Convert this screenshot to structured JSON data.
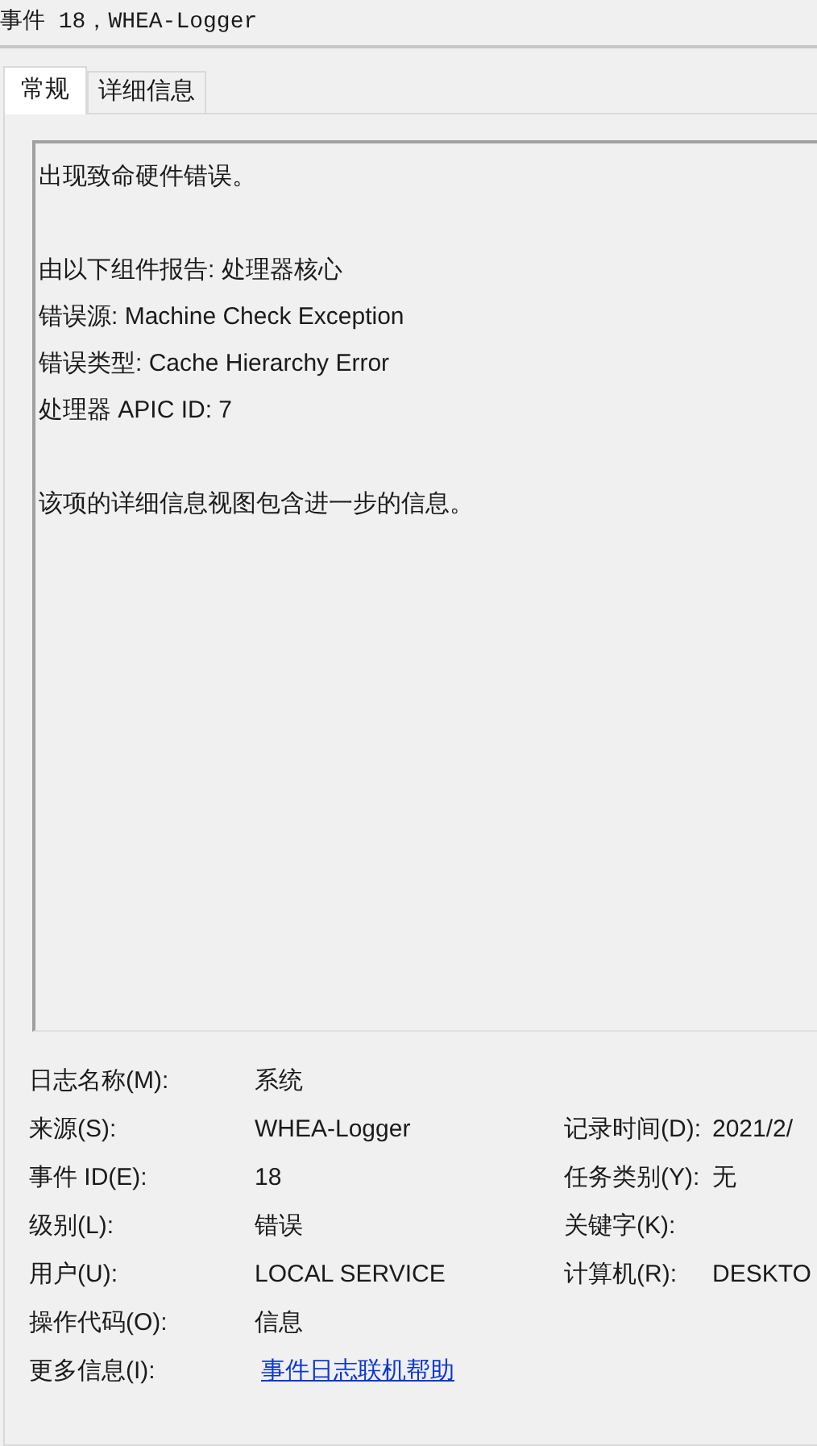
{
  "window": {
    "title": "事件 18，WHEA-Logger"
  },
  "tabs": [
    {
      "label": "常规",
      "selected": true
    },
    {
      "label": "详细信息",
      "selected": false
    }
  ],
  "message": [
    [
      "出现致命硬件错误。"
    ],
    [
      "由以下组件报告: 处理器核心",
      "错误源: Machine Check Exception",
      "错误类型: Cache Hierarchy Error",
      "处理器 APIC ID: 7"
    ],
    [
      "该项的详细信息视图包含进一步的信息。"
    ]
  ],
  "properties": [
    {
      "label": "日志名称(M):",
      "value": "系统",
      "kind": "text"
    },
    {
      "label": "来源(S):",
      "value": "WHEA-Logger",
      "kind": "text",
      "right_label": "记录时间(D):",
      "right_value": "2021/2/"
    },
    {
      "label": "事件 ID(E):",
      "value": "18",
      "kind": "text",
      "right_label": "任务类别(Y):",
      "right_value": "无"
    },
    {
      "label": "级别(L):",
      "value": "错误",
      "kind": "text",
      "right_label": "关键字(K):"
    },
    {
      "label": "用户(U):",
      "value": "LOCAL SERVICE",
      "kind": "text",
      "right_label": "计算机(R):",
      "right_value": "DESKTO"
    },
    {
      "label": "操作代码(O):",
      "value": "信息",
      "kind": "text"
    },
    {
      "label": "更多信息(I):",
      "value": "事件日志联机帮助",
      "kind": "link"
    }
  ]
}
